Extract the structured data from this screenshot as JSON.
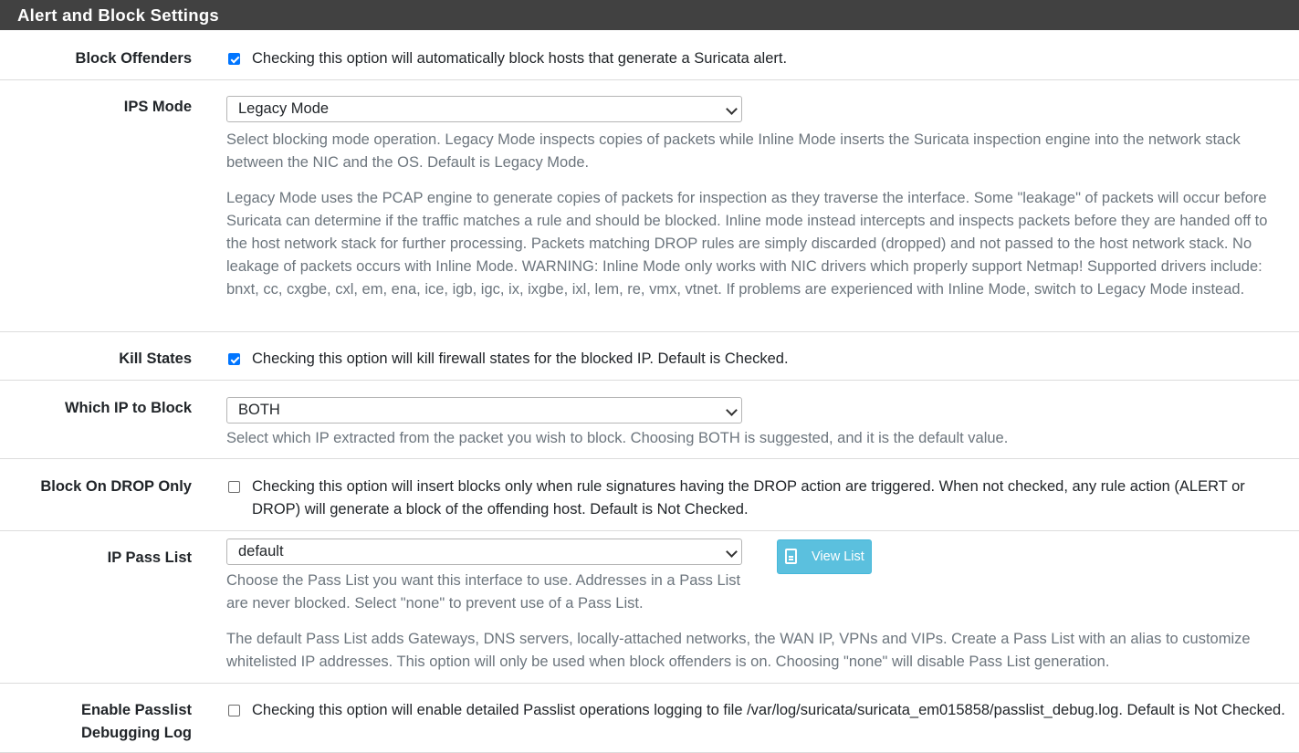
{
  "panel": {
    "title": "Alert and Block Settings"
  },
  "block_offenders": {
    "label": "Block Offenders",
    "checked": true,
    "text": "Checking this option will automatically block hosts that generate a Suricata alert."
  },
  "ips_mode": {
    "label": "IPS Mode",
    "selected": "Legacy Mode",
    "help1": "Select blocking mode operation. Legacy Mode inspects copies of packets while Inline Mode inserts the Suricata inspection engine into the network stack between the NIC and the OS. Default is Legacy Mode.",
    "help2": "Legacy Mode uses the PCAP engine to generate copies of packets for inspection as they traverse the interface. Some \"leakage\" of packets will occur before Suricata can determine if the traffic matches a rule and should be blocked. Inline mode instead intercepts and inspects packets before they are handed off to the host network stack for further processing. Packets matching DROP rules are simply discarded (dropped) and not passed to the host network stack. No leakage of packets occurs with Inline Mode. WARNING: Inline Mode only works with NIC drivers which properly support Netmap! Supported drivers include: bnxt, cc, cxgbe, cxl, em, ena, ice, igb, igc, ix, ixgbe, ixl, lem, re, vmx, vtnet. If problems are experienced with Inline Mode, switch to Legacy Mode instead."
  },
  "kill_states": {
    "label": "Kill States",
    "checked": true,
    "text": "Checking this option will kill firewall states for the blocked IP. Default is Checked."
  },
  "which_ip": {
    "label": "Which IP to Block",
    "selected": "BOTH",
    "help": "Select which IP extracted from the packet you wish to block. Choosing BOTH is suggested, and it is the default value."
  },
  "block_drop_only": {
    "label": "Block On DROP Only",
    "checked": false,
    "text": "Checking this option will insert blocks only when rule signatures having the DROP action are triggered. When not checked, any rule action (ALERT or DROP) will generate a block of the offending host. Default is Not Checked."
  },
  "ip_pass_list": {
    "label": "IP Pass List",
    "selected": "default",
    "button_label": "View List",
    "help1": "Choose the Pass List you want this interface to use. Addresses in a Pass List are never blocked. Select \"none\" to prevent use of a Pass List.",
    "help2": "The default Pass List adds Gateways, DNS servers, locally-attached networks, the WAN IP, VPNs and VIPs. Create a Pass List with an alias to customize whitelisted IP addresses. This option will only be used when block offenders is on. Choosing \"none\" will disable Pass List generation."
  },
  "passlist_debug": {
    "label_line1": "Enable Passlist",
    "label_line2": "Debugging Log",
    "checked": false,
    "text": "Checking this option will enable detailed Passlist operations logging to file /var/log/suricata/suricata_em015858/passlist_debug.log. Default is Not Checked."
  }
}
